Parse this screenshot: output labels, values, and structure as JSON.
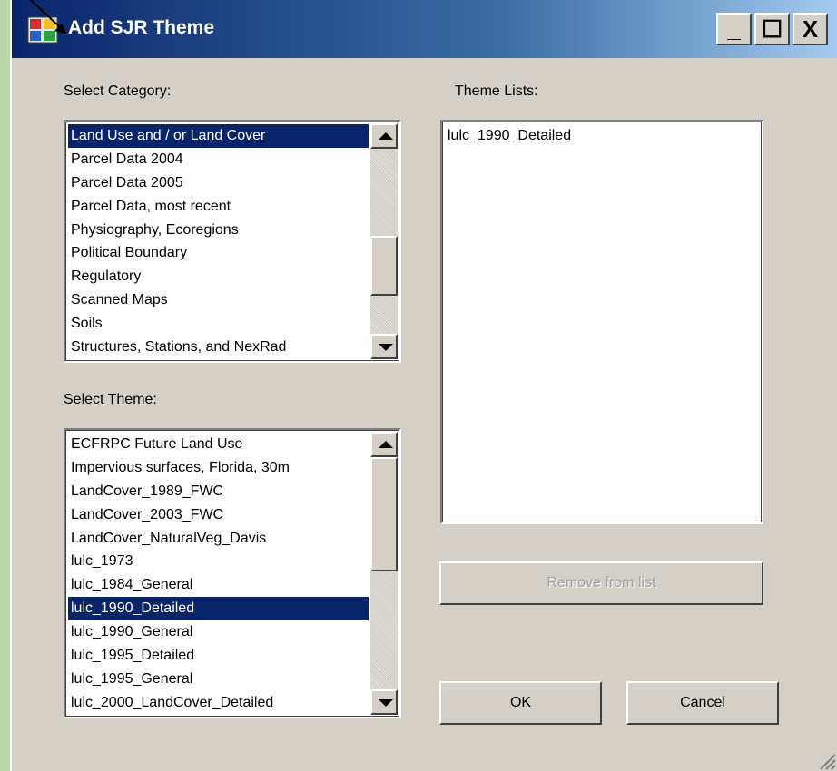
{
  "window": {
    "title": "Add SJR Theme",
    "controls": {
      "minimize": "_",
      "maximize": "☐",
      "close": "X"
    }
  },
  "category": {
    "label": "Select Category:",
    "items": [
      "Land Use and / or Land Cover",
      "Parcel Data 2004",
      "Parcel Data 2005",
      "Parcel Data, most recent",
      "Physiography, Ecoregions",
      "Political Boundary",
      "Regulatory",
      "Scanned Maps",
      "Soils",
      "Structures, Stations, and NexRad"
    ],
    "selected_index": 0
  },
  "theme": {
    "label": "Select Theme:",
    "items": [
      "ECFRPC Future Land Use",
      "Impervious surfaces, Florida, 30m",
      "LandCover_1989_FWC",
      "LandCover_2003_FWC",
      "LandCover_NaturalVeg_Davis",
      "lulc_1973",
      "lulc_1984_General",
      "lulc_1990_Detailed",
      "lulc_1990_General",
      "lulc_1995_Detailed",
      "lulc_1995_General",
      "lulc_2000_LandCover_Detailed"
    ],
    "selected_index": 7
  },
  "theme_lists": {
    "label": "Theme Lists:",
    "items": [
      "lulc_1990_Detailed"
    ]
  },
  "buttons": {
    "remove": "Remove from list",
    "ok": "OK",
    "cancel": "Cancel"
  },
  "colors": {
    "selection": "#0a246a",
    "dialog_bg": "#d4d0c8",
    "titlebar_start": "#0a246a"
  }
}
